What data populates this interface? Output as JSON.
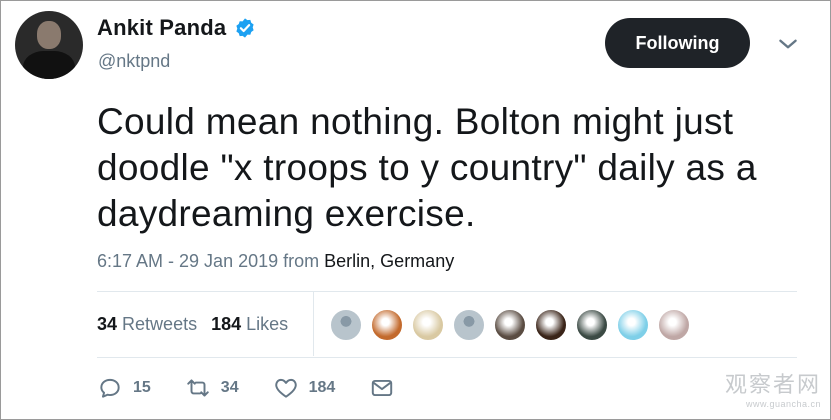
{
  "author": {
    "display_name": "Ankit Panda",
    "handle": "@nktpnd",
    "verified": true
  },
  "follow_button": {
    "label": "Following"
  },
  "menu": {
    "icon": "chevron-down-icon"
  },
  "tweet": {
    "text": "Could mean nothing. Bolton might just doodle \"x troops to y country\" daily as a daydreaming exercise.",
    "timestamp": "6:17 AM - 29 Jan 2019",
    "from_label": "from",
    "location": "Berlin, Germany"
  },
  "stats": {
    "retweets_count": "34",
    "retweets_label": "Retweets",
    "likes_count": "184",
    "likes_label": "Likes"
  },
  "liker_avatars": [
    {
      "color": "#b8c4cc",
      "icon": "default-avatar"
    },
    {
      "color": "#c36a2d",
      "icon": "photo-avatar"
    },
    {
      "color": "#d9c9a2",
      "icon": "photo-avatar"
    },
    {
      "color": "#b8c4cc",
      "icon": "default-avatar"
    },
    {
      "color": "#5a4c42",
      "icon": "photo-avatar"
    },
    {
      "color": "#3a2418",
      "icon": "photo-avatar"
    },
    {
      "color": "#3b4a44",
      "icon": "photo-avatar"
    },
    {
      "color": "#7ecfe8",
      "icon": "photo-avatar"
    },
    {
      "color": "#bfa7a5",
      "icon": "photo-avatar"
    }
  ],
  "actions": {
    "reply_count": "15",
    "retweet_count": "34",
    "like_count": "184"
  },
  "watermark": {
    "text": "观察者网",
    "url": "www.guancha.cn"
  },
  "colors": {
    "verified_blue": "#1da1f2",
    "muted_text": "#657786",
    "follow_button_bg": "#1f2328"
  }
}
